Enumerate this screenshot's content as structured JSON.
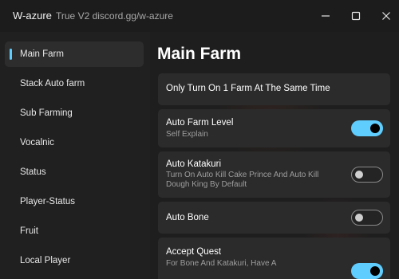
{
  "titlebar": {
    "title": "W-azure",
    "subtitle": "True V2 discord.gg/w-azure"
  },
  "window_controls": {
    "minimize_icon": "minimize-icon",
    "maximize_icon": "maximize-icon",
    "close_icon": "close-icon"
  },
  "sidebar": {
    "items": [
      {
        "label": "Main Farm",
        "active": true
      },
      {
        "label": "Stack Auto farm",
        "active": false
      },
      {
        "label": "Sub Farming",
        "active": false
      },
      {
        "label": "Vocalnic",
        "active": false
      },
      {
        "label": "Status",
        "active": false
      },
      {
        "label": "Player-Status",
        "active": false
      },
      {
        "label": "Fruit",
        "active": false
      },
      {
        "label": "Local Player",
        "active": false
      }
    ]
  },
  "main": {
    "title": "Main Farm",
    "notice": "Only Turn On 1 Farm At The Same Time",
    "options": [
      {
        "title": "Auto Farm Level",
        "desc": "Self Explain",
        "enabled": true
      },
      {
        "title": "Auto Katakuri",
        "desc": "Turn On Auto Kill Cake Prince And Auto Kill Dough King By Default",
        "enabled": false
      },
      {
        "title": "Auto Bone",
        "desc": "",
        "enabled": false
      },
      {
        "title": "Accept Quest",
        "desc": "For Bone And Katakuri, Have A",
        "enabled": true
      }
    ]
  },
  "colors": {
    "accent": "#60cdff",
    "background": "#202020",
    "card": "#2c2c2c",
    "muted_text": "#9e9e9e"
  }
}
